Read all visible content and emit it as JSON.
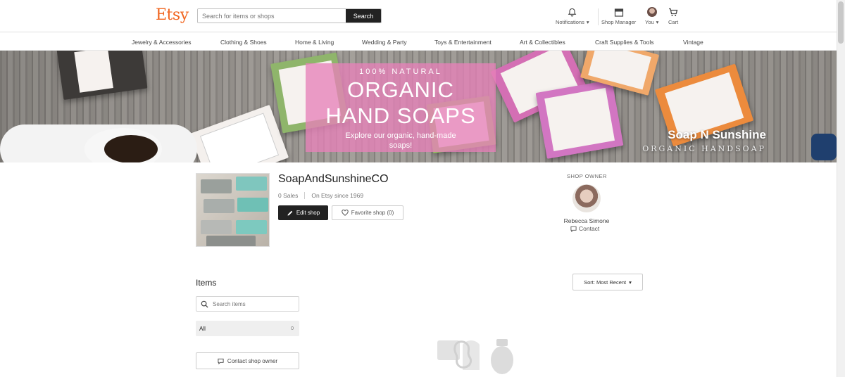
{
  "header": {
    "logo": "Etsy",
    "search_placeholder": "Search for items or shops",
    "search_button": "Search",
    "notifications_label": "Notifications",
    "shop_manager_label": "Shop Manager",
    "you_label": "You",
    "cart_label": "Cart"
  },
  "categories": [
    "Jewelry & Accessories",
    "Clothing & Shoes",
    "Home & Living",
    "Wedding & Party",
    "Toys & Entertainment",
    "Art & Collectibles",
    "Craft Supplies & Tools",
    "Vintage"
  ],
  "banner": {
    "kicker": "100% NATURAL",
    "title_line1": "ORGANIC",
    "title_line2": "HAND SOAPS",
    "subtitle": "Explore our organic, hand-made soaps!",
    "brand_name": "Soap N Sunshine",
    "brand_sub": "ORGANIC HANDSOAP"
  },
  "shop": {
    "name": "SoapAndSunshineCO",
    "sales": "0 Sales",
    "since": "On Etsy since 1969",
    "edit_button": "Edit shop",
    "favorite_button": "Favorite shop (0)"
  },
  "owner": {
    "label": "SHOP OWNER",
    "name": "Rebecca Simone",
    "contact": "Contact"
  },
  "items": {
    "title": "Items",
    "sort_label": "Sort: Most Recent",
    "search_placeholder": "Search items",
    "filter_all": "All",
    "filter_count": "0",
    "contact_owner": "Contact shop owner"
  },
  "colors": {
    "brand": "#f1641e",
    "promo_pink": "#e782b8",
    "button_dark": "#222222"
  }
}
